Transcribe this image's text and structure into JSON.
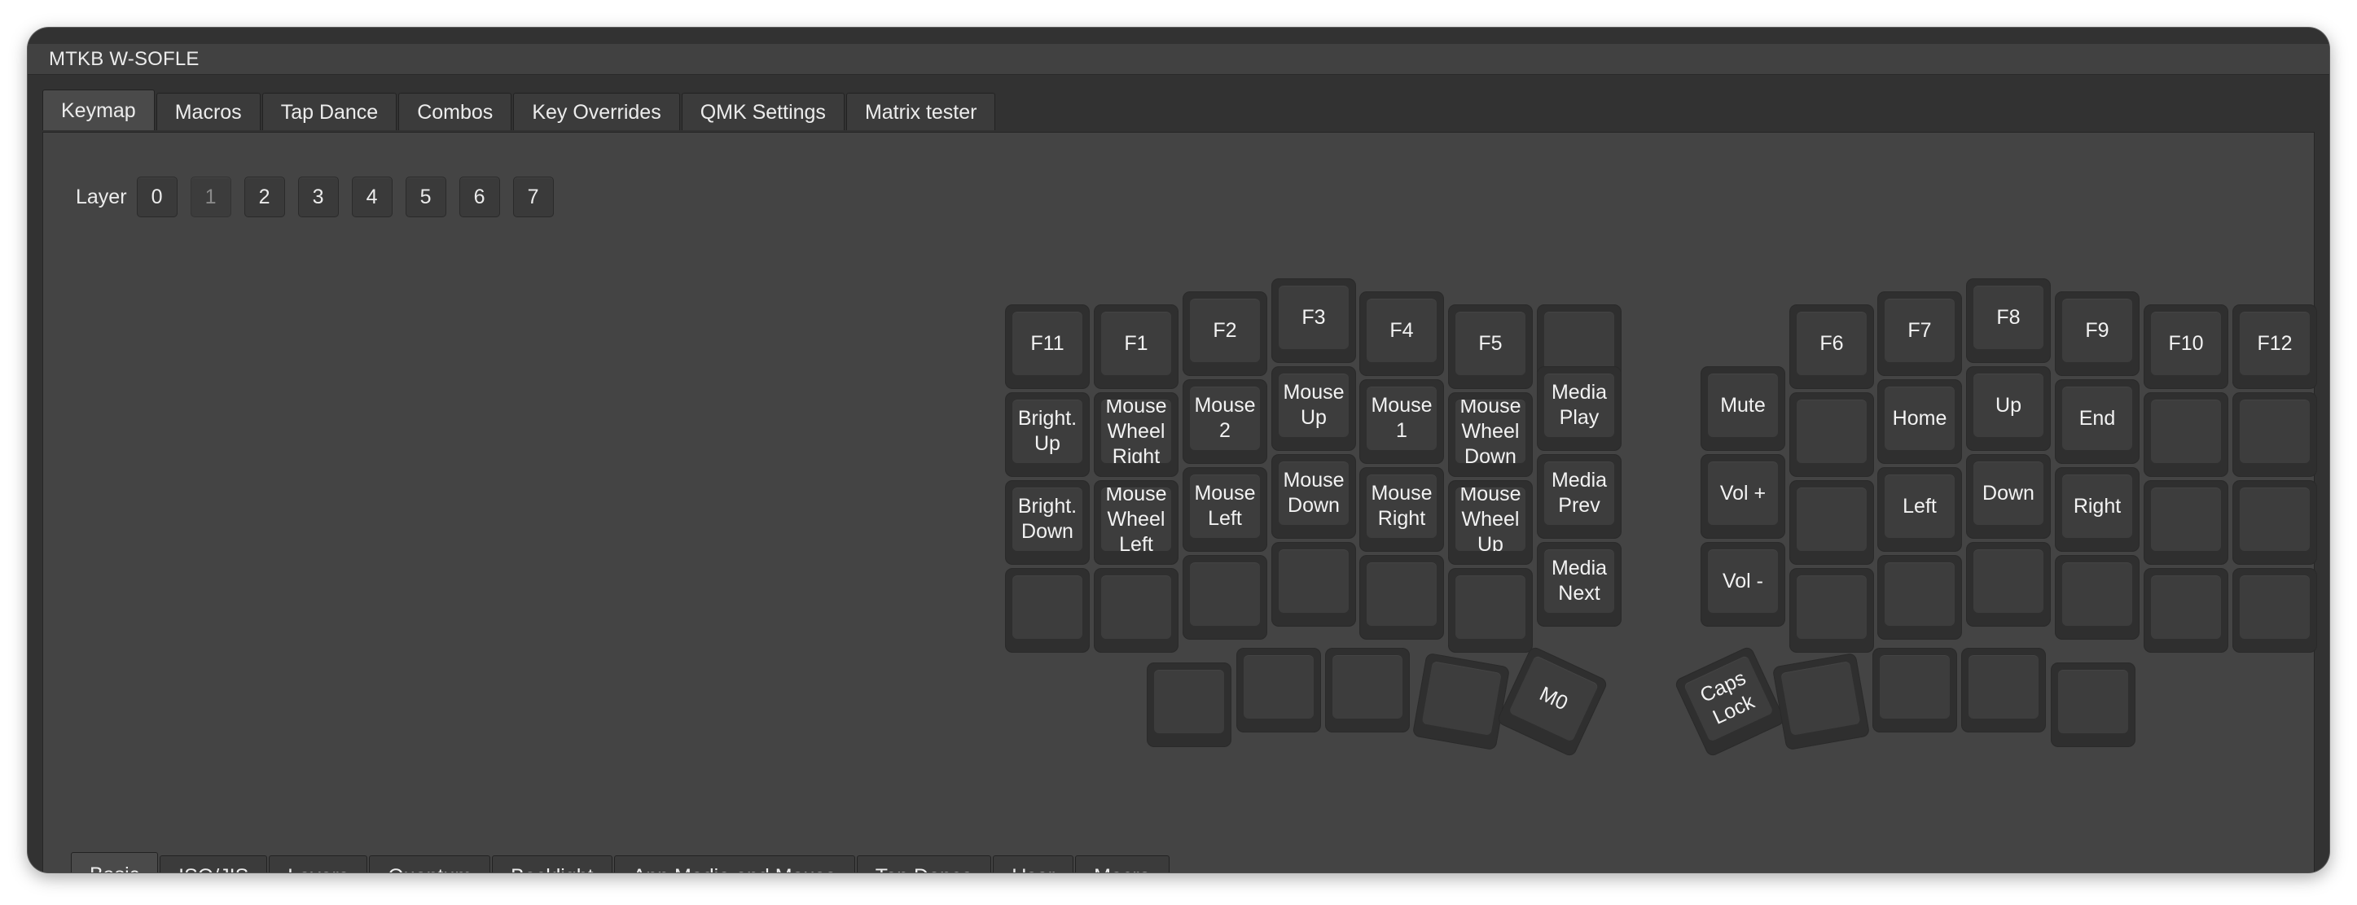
{
  "window": {
    "title": "MTKB W-SOFLE"
  },
  "tabs_top": [
    {
      "label": "Keymap",
      "active": true
    },
    {
      "label": "Macros"
    },
    {
      "label": "Tap Dance"
    },
    {
      "label": "Combos"
    },
    {
      "label": "Key Overrides"
    },
    {
      "label": "QMK Settings"
    },
    {
      "label": "Matrix tester"
    }
  ],
  "layer": {
    "label": "Layer",
    "buttons": [
      "0",
      "1",
      "2",
      "3",
      "4",
      "5",
      "6",
      "7"
    ],
    "active": "1"
  },
  "keys": [
    "F11",
    "F1",
    "F2",
    "F3",
    "F4",
    "F5",
    "",
    "Bright.\nUp",
    "Mouse\nWheel\nRight",
    "Mouse\n2",
    "Mouse\nUp",
    "Mouse\n1",
    "Mouse\nWheel\nDown",
    "Media\nPlay",
    "Bright.\nDown",
    "Mouse\nWheel\nLeft",
    "Mouse\nLeft",
    "Mouse\nDown",
    "Mouse\nRight",
    "Mouse\nWheel\nUp",
    "Media\nPrev",
    "",
    "",
    "",
    "",
    "",
    "",
    "Media\nNext",
    "",
    "",
    "",
    "",
    "M0",
    "F6",
    "F7",
    "F8",
    "F9",
    "F10",
    "F12",
    "Mute",
    "",
    "Home",
    "Up",
    "End",
    "",
    "",
    "Vol +",
    "",
    "Left",
    "Down",
    "Right",
    "",
    "",
    "Vol -",
    "",
    "",
    "",
    "",
    "",
    "",
    "Caps\nLock",
    "",
    "",
    "",
    ""
  ],
  "tabs_bottom": [
    {
      "label": "Basic",
      "active": true
    },
    {
      "label": "ISO/JIS"
    },
    {
      "label": "Layers"
    },
    {
      "label": "Quantum"
    },
    {
      "label": "Backlight"
    },
    {
      "label": "App,Media and Mouse"
    },
    {
      "label": "Tap Dance"
    },
    {
      "label": "User"
    },
    {
      "label": "Macro"
    }
  ],
  "colors": {
    "window_bg": "#323232",
    "pane_bg": "#444444",
    "key_base": "#2f2f2f",
    "key_cap": "#3d3d3d",
    "text": "#ececec"
  }
}
